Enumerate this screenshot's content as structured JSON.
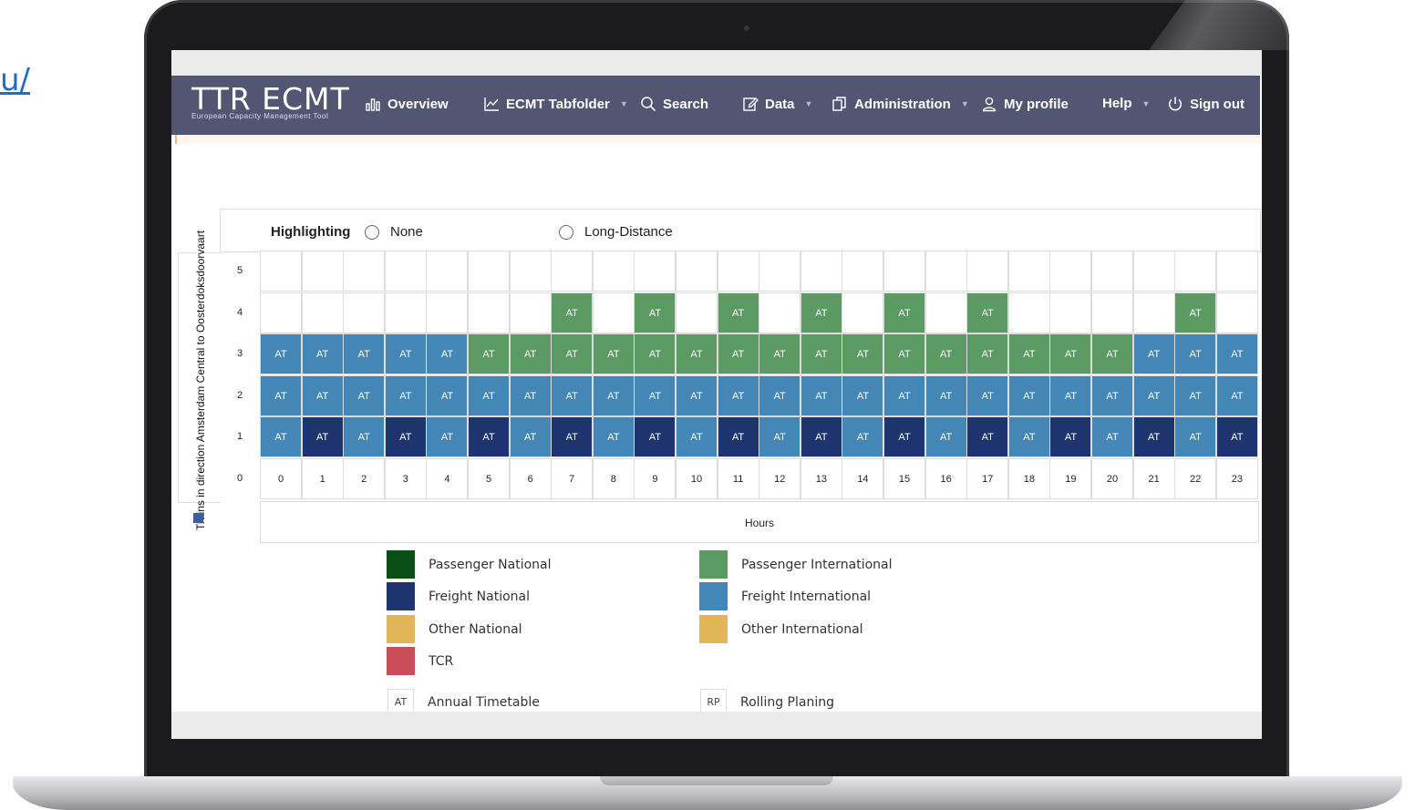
{
  "corner_link": "u/",
  "brand": {
    "logo": "TTR ECMT",
    "subtitle": "European Capacity Management Tool"
  },
  "nav": [
    {
      "label": "Overview",
      "icon": "bar-chart-icon",
      "dropdown": false
    },
    {
      "label": "ECMT Tabfolder",
      "icon": "line-chart-icon",
      "dropdown": true
    },
    {
      "label": "Search",
      "icon": "search-icon",
      "dropdown": false
    },
    {
      "label": "Data",
      "icon": "edit-icon",
      "dropdown": true
    },
    {
      "label": "Administration",
      "icon": "copy-icon",
      "dropdown": true
    },
    {
      "label": "My profile",
      "icon": "user-icon",
      "dropdown": false
    },
    {
      "label": "Help",
      "icon": "",
      "dropdown": true
    },
    {
      "label": "Sign out",
      "icon": "power-icon",
      "dropdown": false
    }
  ],
  "timetable": {
    "y_axis_label": "Trains in direction Amsterdam Central to Oosterdoksdoorvaart",
    "highlighting": {
      "label": "Highlighting",
      "options": [
        "None",
        "Long-Distance"
      ]
    },
    "row_labels": [
      "5",
      "4",
      "3",
      "2",
      "1",
      "0"
    ],
    "hours": [
      "0",
      "1",
      "2",
      "3",
      "4",
      "5",
      "6",
      "7",
      "8",
      "9",
      "10",
      "11",
      "12",
      "13",
      "14",
      "15",
      "16",
      "17",
      "18",
      "19",
      "20",
      "21",
      "22",
      "23"
    ],
    "x_axis_label": "Hours",
    "cell_code": "AT",
    "rows": {
      "5": [
        "",
        "",
        "",
        "",
        "",
        "",
        "",
        "",
        "",
        "",
        "",
        "",
        "",
        "",
        "",
        "",
        "",
        "",
        "",
        "",
        "",
        "",
        "",
        ""
      ],
      "4": [
        "",
        "",
        "",
        "",
        "",
        "",
        "",
        "PI",
        "",
        "PI",
        "",
        "PI",
        "",
        "PI",
        "",
        "PI",
        "",
        "PI",
        "",
        "",
        "",
        "",
        "PI",
        ""
      ],
      "3": [
        "FI",
        "FI",
        "FI",
        "FI",
        "FI",
        "PI",
        "PI",
        "PI",
        "PI",
        "PI",
        "PI",
        "PI",
        "PI",
        "PI",
        "PI",
        "PI",
        "PI",
        "PI",
        "PI",
        "PI",
        "PI",
        "FI",
        "FI",
        "FI"
      ],
      "2": [
        "FI",
        "FI",
        "FI",
        "FI",
        "FI",
        "FI",
        "FI",
        "FI",
        "FI",
        "FI",
        "FI",
        "FI",
        "FI",
        "FI",
        "FI",
        "FI",
        "FI",
        "FI",
        "FI",
        "FI",
        "FI",
        "FI",
        "FI",
        "FI"
      ],
      "1": [
        "FI",
        "FN",
        "FI",
        "FN",
        "FI",
        "FN",
        "FI",
        "FN",
        "FI",
        "FN",
        "FI",
        "FN",
        "FI",
        "FN",
        "FI",
        "FN",
        "FI",
        "FN",
        "FI",
        "FN",
        "FI",
        "FN",
        "FI",
        "FN"
      ]
    },
    "category_colors": {
      "PN": "#0b4f16",
      "PI": "#5c9a64",
      "FN": "#1e346e",
      "FI": "#4487b7",
      "ON": "#e0b659",
      "OI": "#e0b659",
      "TCR": "#cc4d5a"
    }
  },
  "legend": {
    "left": [
      {
        "label": "Passenger National",
        "color": "#0b4f16"
      },
      {
        "label": "Freight National",
        "color": "#1e346e"
      },
      {
        "label": "Other National",
        "color": "#e0b659"
      },
      {
        "label": "TCR",
        "color": "#cc4d5a"
      }
    ],
    "right": [
      {
        "label": "Passenger International",
        "color": "#5c9a64"
      },
      {
        "label": "Freight International",
        "color": "#4487b7"
      },
      {
        "label": "Other International",
        "color": "#e0b659"
      }
    ],
    "codes": [
      {
        "code": "AT",
        "label": "Annual Timetable"
      },
      {
        "code": "RP",
        "label": "Rolling Planing"
      }
    ]
  }
}
